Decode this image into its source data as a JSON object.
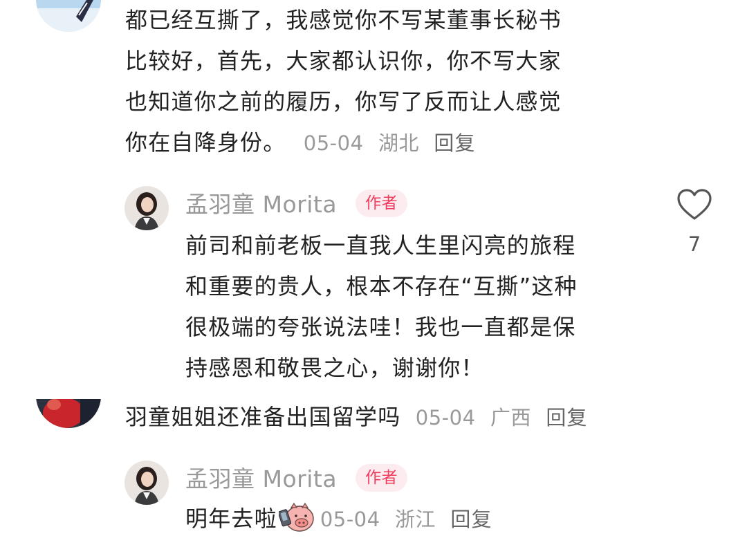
{
  "comment1": {
    "lines": [
      "都已经互撕了，我感觉你不写某董事长秘书",
      "比较好，首先，大家都认识你，你不写大家",
      "也知道你之前的履历，你写了反而让人感觉",
      "你在自降身份。"
    ],
    "date": "05-04",
    "location": "湖北",
    "reply_label": "回复"
  },
  "reply1": {
    "author": "孟羽童 Morita",
    "author_tag": "作者",
    "lines": [
      "前司和前老板一直我人生里闪亮的旅程",
      "和重要的贵人，根本不存在“互撕”这种",
      "很极端的夸张说法哇！我也一直都是保",
      "持感恩和敬畏之心，谢谢你！"
    ],
    "like_count": "7"
  },
  "comment2": {
    "text": "羽童姐姐还准备出国留学吗",
    "date": "05-04",
    "location": "广西",
    "reply_label": "回复"
  },
  "reply2": {
    "author": "孟羽童 Morita",
    "author_tag": "作者",
    "text": "明年去啦",
    "emoji_icon": "pig-phone-emoji-icon",
    "date": "05-04",
    "location": "浙江",
    "reply_label": "回复"
  },
  "colors": {
    "author_tag_bg": "#fdecef",
    "author_tag_text": "#ee3d5e",
    "meta_text": "#999999"
  }
}
